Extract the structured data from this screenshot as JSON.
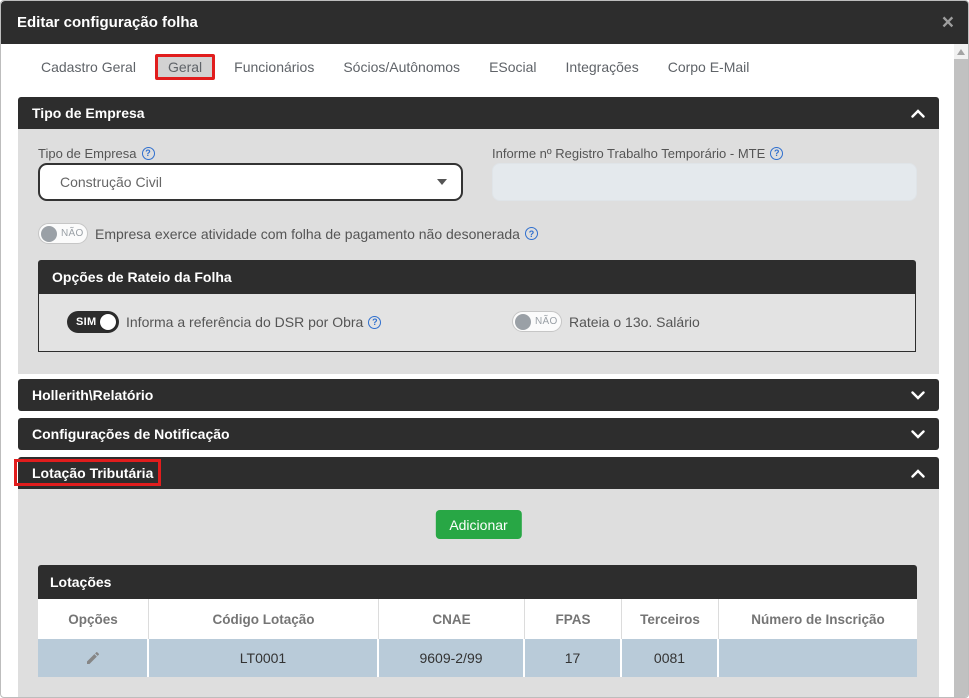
{
  "header": {
    "title": "Editar configuração folha"
  },
  "icons": {
    "close": "×",
    "help": "?"
  },
  "colors": {
    "dark_bar": "#2d2d2d",
    "section_body": "#dedede",
    "annotation_red": "#e11d1d",
    "add_button_green": "#28a745",
    "help_blue": "#2f6fce",
    "table_row_blue": "#b9cbd9"
  },
  "tabs": {
    "selected": "Geral",
    "items": [
      {
        "label": "Cadastro Geral"
      },
      {
        "label": "Geral"
      },
      {
        "label": "Funcionários"
      },
      {
        "label": "Sócios/Autônomos"
      },
      {
        "label": "ESocial"
      },
      {
        "label": "Integrações"
      },
      {
        "label": "Corpo E-Mail"
      }
    ]
  },
  "tipo_empresa": {
    "title": "Tipo de Empresa",
    "collapse_state": "expanded",
    "tipo_label": "Tipo de Empresa",
    "tipo_value": "Construção Civil",
    "mte_label": "Informe nº Registro Trabalho Temporário - MTE",
    "mte_value": "",
    "desonerada_toggle": {
      "state": "NÃO",
      "label": "Empresa exerce atividade com folha de pagamento não desonerada"
    },
    "rateio": {
      "title": "Opções de Rateio da Folha",
      "dsr_toggle": {
        "state": "SIM",
        "label": "Informa a referência do DSR por Obra"
      },
      "salario_toggle": {
        "state": "NÃO",
        "label": "Rateia o 13o. Salário"
      }
    }
  },
  "hollerith": {
    "title": "Hollerith\\Relatório",
    "collapse_state": "collapsed"
  },
  "notificacao": {
    "title": "Configurações de Notificação",
    "collapse_state": "collapsed"
  },
  "lotacao": {
    "title": "Lotação Tributária",
    "collapse_state": "expanded",
    "add_button": "Adicionar",
    "table": {
      "title": "Lotações",
      "columns": [
        "Opções",
        "Código Lotação",
        "CNAE",
        "FPAS",
        "Terceiros",
        "Número de Inscrição"
      ],
      "rows": [
        {
          "codigo": "LT0001",
          "cnae": "9609-2/99",
          "fpas": "17",
          "terceiros": "0081",
          "inscricao": ""
        }
      ]
    }
  }
}
